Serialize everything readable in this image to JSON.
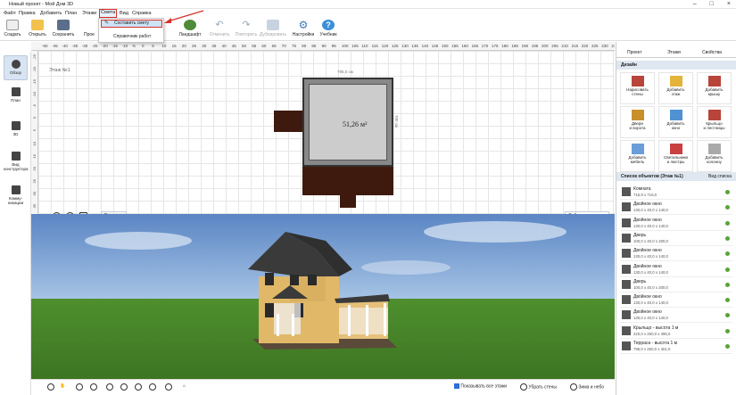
{
  "window": {
    "title": "Новый проект - Мой Дом 3D"
  },
  "menu": [
    "Файл",
    "Правка",
    "Добавить",
    "План",
    "Этажи",
    "Смета",
    "Вид",
    "Справка"
  ],
  "dropdown": {
    "item1": "Составить смету",
    "item2": "Справочник работ"
  },
  "toolbar": [
    "Создать",
    "Открыть",
    "Сохранить",
    "Прое",
    "т",
    "Ландшафт",
    "Отменить",
    "Повторить",
    "Дублировать",
    "Настройки",
    "Учебник"
  ],
  "ruler": {
    "top": [
      "-50",
      "-45",
      "-40",
      "-35",
      "-30",
      "-25",
      "-20",
      "-15",
      "-10",
      "-5",
      "0",
      "5",
      "10",
      "15",
      "20",
      "25",
      "30",
      "35",
      "40",
      "45",
      "50",
      "55",
      "60",
      "65",
      "70",
      "75",
      "80",
      "85",
      "90",
      "95",
      "100",
      "105",
      "110",
      "115",
      "120",
      "125",
      "130",
      "135",
      "140",
      "145",
      "150",
      "155",
      "160",
      "165",
      "170",
      "175",
      "180",
      "185",
      "190",
      "195",
      "200",
      "205",
      "210",
      "215",
      "220",
      "225",
      "230",
      "235"
    ],
    "left": [
      "-25",
      "-20",
      "-15",
      "-10",
      "-5",
      "0",
      "5",
      "10",
      "15",
      "20",
      "25",
      "30",
      "35"
    ]
  },
  "left_panel": {
    "items": [
      "Обзор",
      "План",
      "3D",
      "Вид\nконструктора",
      "Комму-\nникации"
    ]
  },
  "plan": {
    "floor_label": "Этаж №1",
    "area": "51,26 м²",
    "dim_top": "795,0 см",
    "dim_right": "700 см",
    "tools_size": "Размеры",
    "work_with_floors": "Работа с этажами"
  },
  "bottom": {
    "show_all": "Показывать все этажи",
    "remove_walls": "Убрать стены",
    "season": "Зима и небо"
  },
  "right_panel": {
    "tabs": [
      "Проект",
      "Этажи",
      "Свойства"
    ],
    "design_header": "Дизайн",
    "design_items": [
      "Нарисовать\nстены",
      "Добавить\nэтаж",
      "Добавить\nкрышу",
      "Двери\nи ворота",
      "Добавить\nокно",
      "Крыльцо\nи лестницы",
      "Добавить\nмебель",
      "Светильники\nи люстры",
      "Добавить\nколонну"
    ],
    "list_header": "Список объектов (Этаж №1)",
    "list_view": "Вид списка",
    "objects": [
      {
        "name": "Комната",
        "size": "715,9 x 716,0"
      },
      {
        "name": "Двойное окно",
        "size": "130,0 x 40,0 x 140,0"
      },
      {
        "name": "Двойное окно",
        "size": "130,0 x 40,0 x 140,0"
      },
      {
        "name": "Дверь",
        "size": "100,0 x 40,0 x 200,0"
      },
      {
        "name": "Двойное окно",
        "size": "130,0 x 40,0 x 140,0"
      },
      {
        "name": "Двойное окно",
        "size": "130,0 x 40,0 x 140,0"
      },
      {
        "name": "Дверь",
        "size": "100,0 x 40,0 x 200,0"
      },
      {
        "name": "Двойное окно",
        "size": "130,0 x 40,0 x 140,0"
      },
      {
        "name": "Двойное окно",
        "size": "130,0 x 40,0 x 140,0"
      },
      {
        "name": "Крыльцо - высота 1 м",
        "size": "220,0 x 250,0 x 495,0"
      },
      {
        "name": "Терраса - высота 1 м",
        "size": "795,0 x 250,0 x 401,0"
      }
    ]
  }
}
